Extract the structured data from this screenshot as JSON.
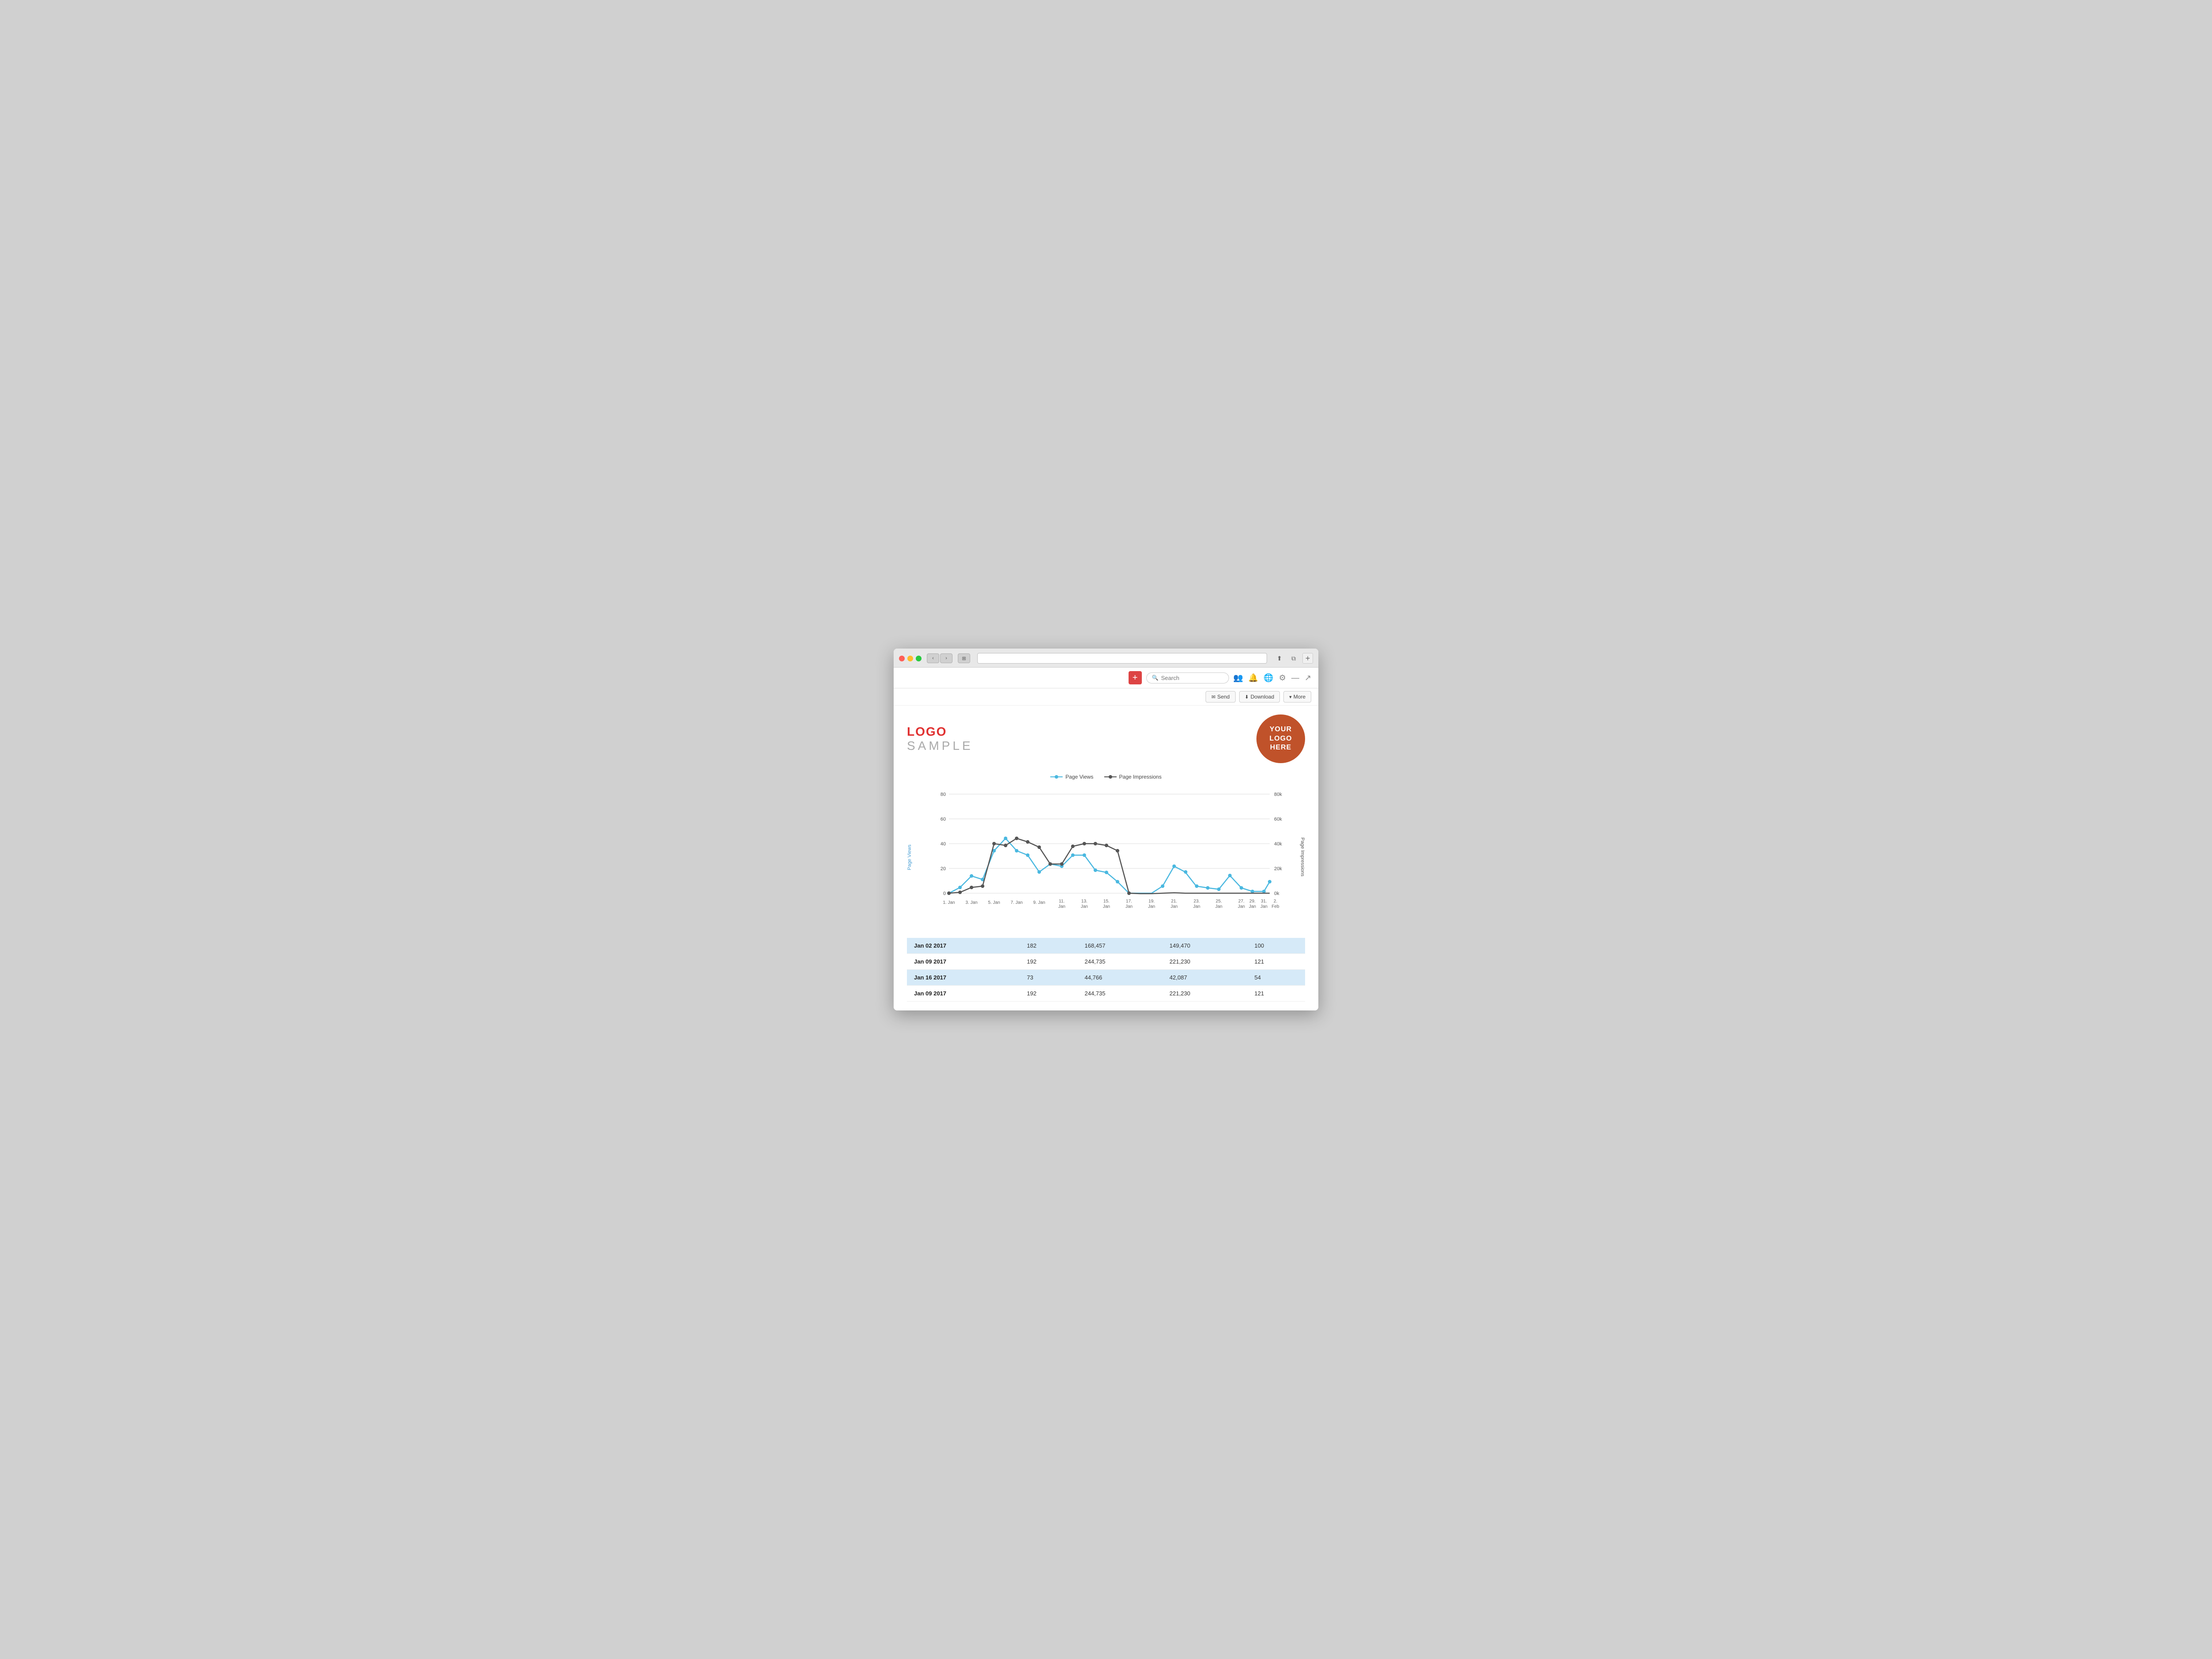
{
  "browser": {
    "traffic_lights": [
      "red",
      "yellow",
      "green"
    ],
    "nav_back": "‹",
    "nav_forward": "›",
    "window_icon": "⊞",
    "address_bar_value": "",
    "action_icons": [
      "⬆",
      "⧉",
      "+"
    ]
  },
  "toolbar": {
    "add_label": "+",
    "search_placeholder": "Search",
    "icons": [
      "👥",
      "🔔",
      "🌐",
      "⚙",
      "—",
      "↗"
    ]
  },
  "action_buttons": [
    {
      "label": "Send",
      "icon": "✉"
    },
    {
      "label": "Download",
      "icon": "⬇"
    },
    {
      "label": "More",
      "icon": "▾"
    }
  ],
  "header": {
    "logo_top": "LOGO",
    "logo_bottom": "SAMPLE",
    "circle_logo_line1": "YOUR",
    "circle_logo_line2": "LOGO",
    "circle_logo_line3": "HERE"
  },
  "chart": {
    "legend": [
      {
        "label": "Page Views",
        "color": "#4ab8e0"
      },
      {
        "label": "Page Impressions",
        "color": "#555"
      }
    ],
    "y_axis_left_label": "Page Views",
    "y_axis_right_label": "Page Impressions",
    "y_left_ticks": [
      "0",
      "20",
      "40",
      "60",
      "80"
    ],
    "y_right_ticks": [
      "0k",
      "20k",
      "40k",
      "60k",
      "80k"
    ],
    "x_labels": [
      "1. Jan",
      "3. Jan",
      "5. Jan",
      "7. Jan",
      "9. Jan",
      "11. Jan",
      "13. Jan",
      "15. Jan",
      "17. Jan",
      "19. Jan",
      "21. Jan",
      "23. Jan",
      "25. Jan",
      "27. Jan",
      "29. Jan",
      "31. Jan",
      "2. Feb"
    ],
    "pageviews_data": [
      2,
      5,
      15,
      12,
      42,
      50,
      38,
      33,
      18,
      26,
      23,
      33,
      33,
      20,
      18,
      7,
      3,
      2,
      1,
      6,
      21,
      15,
      6,
      5,
      4,
      14,
      5,
      2,
      3,
      13
    ],
    "impressions_data": [
      1,
      2,
      8,
      10,
      40,
      42,
      48,
      44,
      38,
      22,
      22,
      34,
      37,
      36,
      35,
      30,
      1,
      0,
      1,
      1,
      1,
      2,
      1,
      2,
      1,
      1,
      1,
      1,
      1,
      1
    ]
  },
  "table": {
    "rows": [
      {
        "date": "Jan 02 2017",
        "col2": "182",
        "col3": "168,457",
        "col4": "149,470",
        "col5": "100",
        "highlighted": true
      },
      {
        "date": "Jan 09 2017",
        "col2": "192",
        "col3": "244,735",
        "col4": "221,230",
        "col5": "121",
        "highlighted": false
      },
      {
        "date": "Jan 16 2017",
        "col2": "73",
        "col3": "44,766",
        "col4": "42,087",
        "col5": "54",
        "highlighted": true
      },
      {
        "date": "Jan 09 2017",
        "col2": "192",
        "col3": "244,735",
        "col4": "221,230",
        "col5": "121",
        "highlighted": false
      }
    ]
  }
}
